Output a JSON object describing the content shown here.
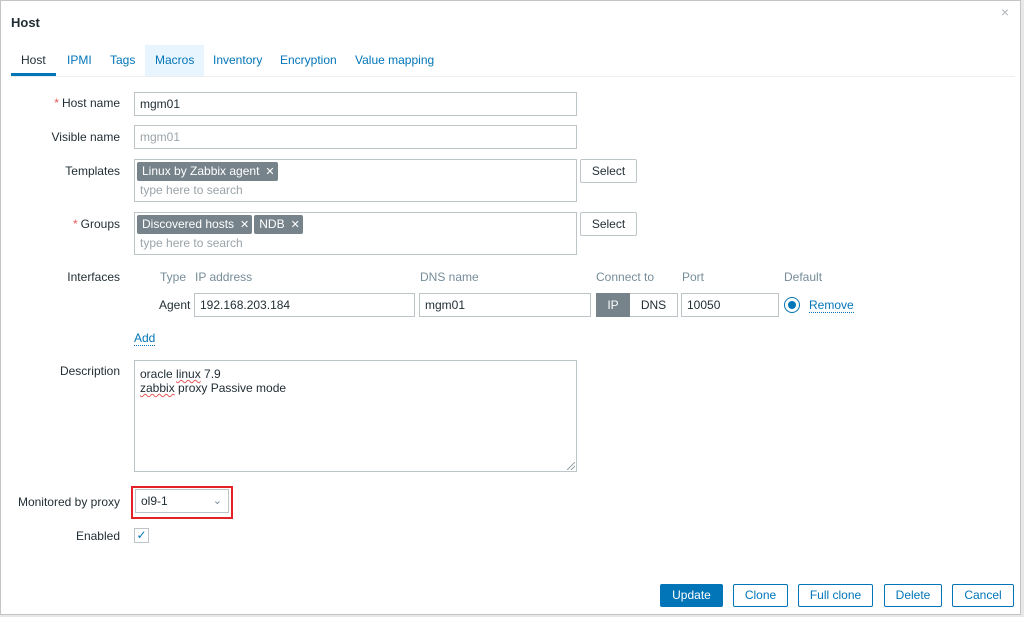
{
  "dialog": {
    "title": "Host",
    "close_label": "×"
  },
  "tabs": [
    {
      "label": "Host",
      "active": true
    },
    {
      "label": "IPMI"
    },
    {
      "label": "Tags"
    },
    {
      "label": "Macros"
    },
    {
      "label": "Inventory"
    },
    {
      "label": "Encryption"
    },
    {
      "label": "Value mapping"
    }
  ],
  "form": {
    "host_name": {
      "label": "Host name",
      "required_mark": "*",
      "value": "mgm01"
    },
    "visible_name": {
      "label": "Visible name",
      "placeholder": "mgm01"
    },
    "templates": {
      "label": "Templates",
      "chips": [
        "Linux by Zabbix agent"
      ],
      "search_placeholder": "type here to search",
      "select_label": "Select"
    },
    "groups": {
      "label": "Groups",
      "required_mark": "*",
      "chips": [
        "Discovered hosts",
        "NDB"
      ],
      "search_placeholder": "type here to search",
      "select_label": "Select"
    },
    "interfaces": {
      "label": "Interfaces",
      "columns": {
        "type": "Type",
        "ip": "IP address",
        "dns": "DNS name",
        "connect_to": "Connect to",
        "port": "Port",
        "default": "Default"
      },
      "rows": [
        {
          "type": "Agent",
          "ip": "192.168.203.184",
          "dns": "mgm01",
          "connect_ip_label": "IP",
          "connect_dns_label": "DNS",
          "port": "10050",
          "remove_label": "Remove"
        }
      ],
      "add_label": "Add"
    },
    "description": {
      "label": "Description",
      "line1_prefix": "oracle ",
      "line1_squiggle": "linux",
      "line1_suffix": " 7.9",
      "line2_squiggle": "zabbix",
      "line2_suffix": " proxy Passive mode"
    },
    "proxy": {
      "label": "Monitored by proxy",
      "value": "ol9-1",
      "highlight_color": "#e32227"
    },
    "enabled": {
      "label": "Enabled",
      "checked": true
    }
  },
  "footer": {
    "update": "Update",
    "clone": "Clone",
    "full_clone": "Full clone",
    "delete": "Delete",
    "cancel": "Cancel"
  },
  "colors": {
    "accent": "#0275b8",
    "required": "#e45959",
    "chip_bg": "#76838a"
  }
}
